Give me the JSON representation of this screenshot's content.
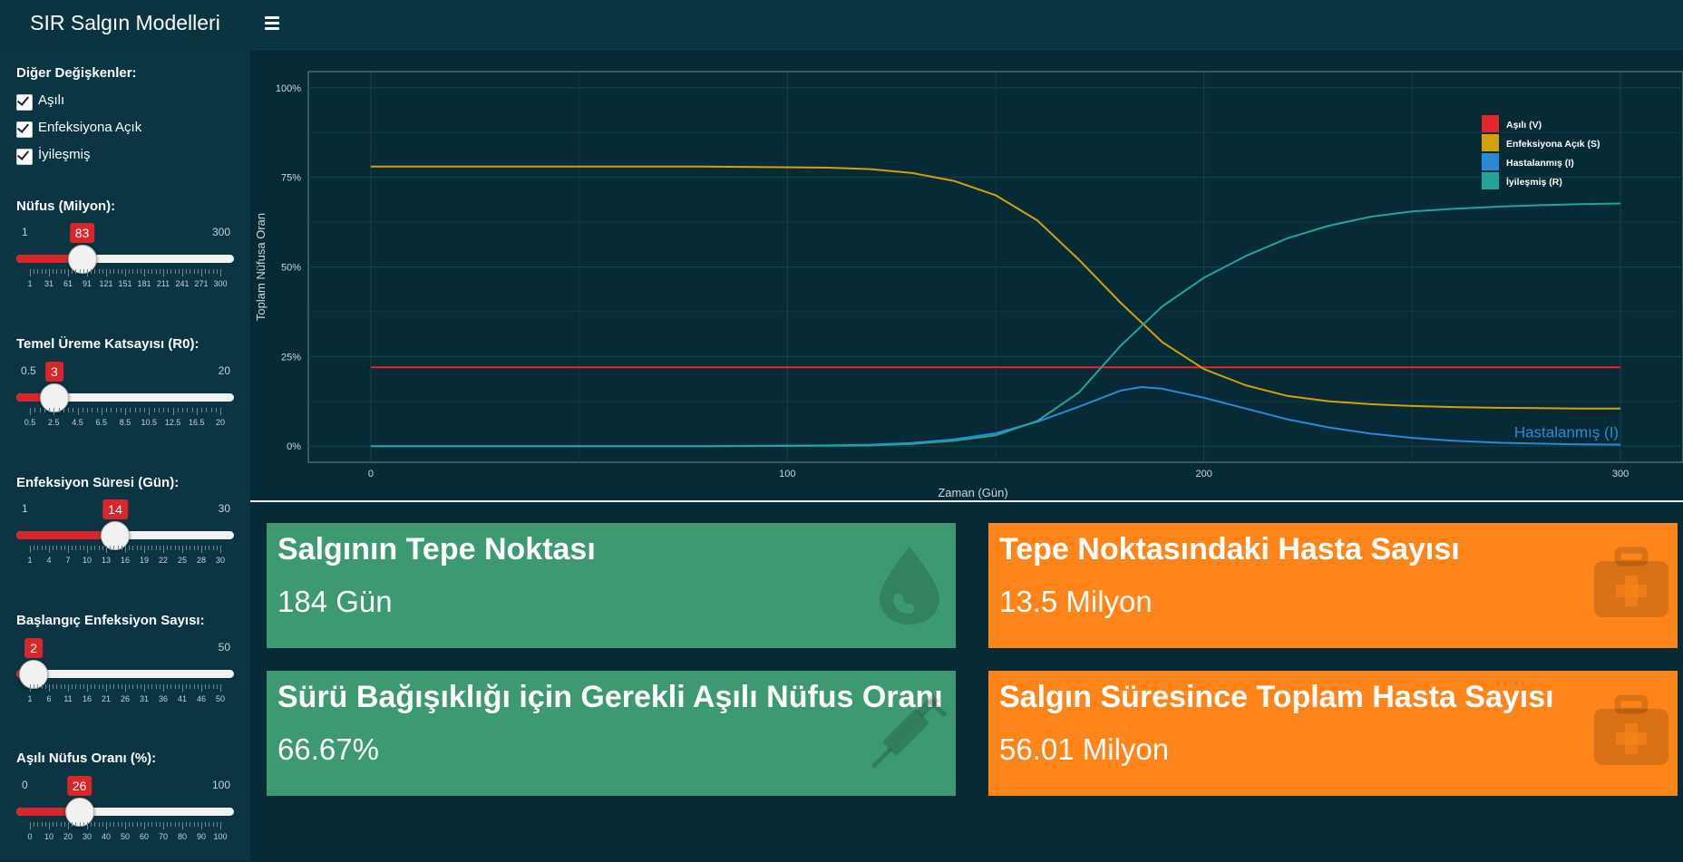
{
  "header": {
    "title": "SIR Salgın Modelleri"
  },
  "sidebar": {
    "checkbox_group_label": "Diğer Değişkenler:",
    "checkboxes": [
      {
        "label": "Aşılı",
        "checked": true
      },
      {
        "label": "Enfeksiyona Açık",
        "checked": true
      },
      {
        "label": "İyileşmiş",
        "checked": true
      }
    ],
    "sliders": [
      {
        "label": "Nüfus (Milyon):",
        "min": "1",
        "max": "300",
        "value": "83",
        "fraction": 0.274,
        "ticks": [
          "1",
          "31",
          "61",
          "91",
          "121",
          "151",
          "181",
          "211",
          "241",
          "271",
          "300"
        ]
      },
      {
        "label": "Temel Üreme Katsayısı (R0):",
        "min": "0.5",
        "max": "20",
        "value": "3",
        "fraction": 0.128,
        "ticks": [
          "0.5",
          "2.5",
          "4.5",
          "6.5",
          "8.5",
          "10.5",
          "12.5",
          "16.5",
          "20"
        ]
      },
      {
        "label": "Enfeksiyon Süresi (Gün):",
        "min": "1",
        "max": "30",
        "value": "14",
        "fraction": 0.448,
        "ticks": [
          "1",
          "4",
          "7",
          "10",
          "13",
          "16",
          "19",
          "22",
          "25",
          "28",
          "30"
        ]
      },
      {
        "label": "Başlangıç Enfeksiyon Sayısı:",
        "min": "",
        "max": "50",
        "value": "2",
        "fraction": 0.02,
        "ticks": [
          "1",
          "6",
          "11",
          "16",
          "21",
          "26",
          "31",
          "36",
          "41",
          "46",
          "50"
        ]
      },
      {
        "label": "Aşılı Nüfus Oranı (%):",
        "min": "0",
        "max": "100",
        "value": "26",
        "fraction": 0.26,
        "ticks": [
          "0",
          "10",
          "20",
          "30",
          "40",
          "50",
          "60",
          "70",
          "80",
          "90",
          "100"
        ]
      }
    ]
  },
  "chart_data": {
    "type": "line",
    "xlabel": "Zaman (Gün)",
    "ylabel": "Toplam Nüfusa Oran",
    "xlim": [
      -15,
      315
    ],
    "ylim": [
      -0.045,
      1.045
    ],
    "x_ticks": [
      "0",
      "100",
      "200",
      "300"
    ],
    "y_ticks": [
      "0%",
      "25%",
      "50%",
      "75%",
      "100%"
    ],
    "legend_position": "top-right",
    "annotation": "Hastalanmış (I)",
    "series": [
      {
        "name": "Aşılı (V)",
        "color": "#e5262b",
        "x": [
          0,
          300
        ],
        "y": [
          0.22,
          0.22
        ]
      },
      {
        "name": "Enfeksiyona Açık (S)",
        "color": "#d4a10c",
        "x": [
          0,
          40,
          80,
          110,
          120,
          130,
          140,
          150,
          160,
          170,
          180,
          190,
          200,
          210,
          220,
          230,
          240,
          250,
          260,
          270,
          280,
          290,
          300
        ],
        "y": [
          0.78,
          0.78,
          0.78,
          0.777,
          0.773,
          0.762,
          0.74,
          0.7,
          0.63,
          0.52,
          0.4,
          0.29,
          0.215,
          0.17,
          0.14,
          0.125,
          0.117,
          0.112,
          0.109,
          0.107,
          0.106,
          0.105,
          0.105
        ]
      },
      {
        "name": "Hastalanmış (I)",
        "color": "#2b8ad6",
        "x": [
          0,
          40,
          80,
          110,
          120,
          130,
          140,
          150,
          160,
          170,
          180,
          185,
          190,
          200,
          210,
          220,
          230,
          240,
          250,
          260,
          270,
          280,
          290,
          300
        ],
        "y": [
          0.0,
          0.0,
          0.0,
          0.002,
          0.004,
          0.009,
          0.019,
          0.036,
          0.068,
          0.11,
          0.155,
          0.165,
          0.16,
          0.135,
          0.105,
          0.075,
          0.052,
          0.035,
          0.023,
          0.015,
          0.01,
          0.007,
          0.005,
          0.004
        ]
      },
      {
        "name": "İyileşmiş (R)",
        "color": "#1fa59a",
        "x": [
          0,
          40,
          80,
          110,
          120,
          130,
          140,
          150,
          160,
          170,
          180,
          190,
          200,
          210,
          220,
          230,
          240,
          250,
          260,
          270,
          280,
          290,
          300
        ],
        "y": [
          0.0,
          0.0,
          0.0,
          0.001,
          0.002,
          0.006,
          0.015,
          0.03,
          0.07,
          0.15,
          0.28,
          0.39,
          0.47,
          0.53,
          0.58,
          0.615,
          0.64,
          0.655,
          0.662,
          0.668,
          0.672,
          0.675,
          0.677
        ]
      }
    ]
  },
  "info_boxes": [
    {
      "title": "Salgının Tepe Noktası",
      "value": "184 Gün",
      "icon": "tint-icon",
      "color": "#3d9970"
    },
    {
      "title": "Tepe Noktasındaki Hasta Sayısı",
      "value": "13.5 Milyon",
      "icon": "medkit-icon",
      "color": "#ff851b"
    },
    {
      "title": "Sürü Bağışıklığı için Gerekli Aşılı Nüfus Oranı",
      "value": "66.67%",
      "icon": "syringe-icon",
      "color": "#3d9970"
    },
    {
      "title": "Salgın Süresince Toplam Hasta Sayısı",
      "value": "56.01 Milyon",
      "icon": "medkit-icon",
      "color": "#ff851b"
    }
  ]
}
